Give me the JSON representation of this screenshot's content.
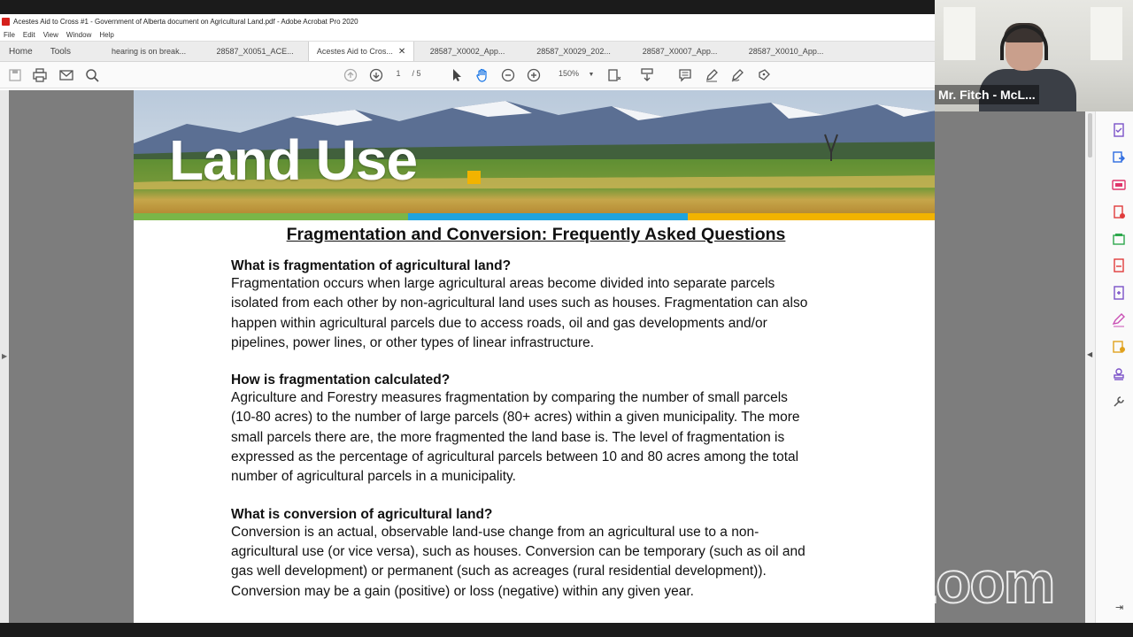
{
  "window": {
    "title": "Acestes Aid to Cross #1 - Government of Alberta document on Agricultural Land.pdf - Adobe Acrobat Pro 2020"
  },
  "menu": [
    "File",
    "Edit",
    "View",
    "Window",
    "Help"
  ],
  "nav_tabs": [
    "Home",
    "Tools"
  ],
  "doc_tabs": [
    {
      "label": "hearing is on break..."
    },
    {
      "label": "28587_X0051_ACE..."
    },
    {
      "label": "Acestes Aid to Cros...",
      "active": true
    },
    {
      "label": "28587_X0002_App..."
    },
    {
      "label": "28587_X0029_202..."
    },
    {
      "label": "28587_X0007_App..."
    },
    {
      "label": "28587_X0010_App..."
    }
  ],
  "toolbar": {
    "page_current": "1",
    "page_total": "/ 5",
    "zoom": "150%"
  },
  "document": {
    "banner_title": "Land Use",
    "banner_dot": ".",
    "stripe_colors": [
      "#7ab648",
      "#1fa3dd",
      "#f2b300"
    ],
    "heading": "Fragmentation and Conversion: Frequently Asked Questions",
    "sections": [
      {
        "question": "What is fragmentation of agricultural land?",
        "lines": [
          "Fragmentation occurs when large agricultural areas become divided into separate parcels",
          "isolated from each other by non-agricultural land uses such as houses.  Fragmentation can also",
          "happen within agricultural parcels due to access roads, oil and gas developments and/or",
          "pipelines, power lines, or other types of linear infrastructure."
        ]
      },
      {
        "question": "How is fragmentation calculated?",
        "lines": [
          "Agriculture and Forestry measures fragmentation by comparing the number of small parcels",
          "(10-80 acres) to the number of large parcels (80+ acres) within a given municipality.  The more",
          "small parcels there are, the more fragmented the land base is.  The level of fragmentation is",
          "expressed as the percentage of agricultural parcels between 10 and 80 acres among the total",
          "number of agricultural parcels in a municipality."
        ]
      },
      {
        "question": "What is conversion of agricultural land?",
        "lines": [
          "Conversion is an actual, observable land-use change from an agricultural use to a non-",
          "agricultural use (or vice versa), such as houses.  Conversion can be temporary (such as oil and",
          "gas well development) or permanent (such as acreages (rural residential development)).",
          "Conversion may be a gain (positive) or loss (negative) within any given year."
        ]
      }
    ]
  },
  "video": {
    "participant_name": "Mr. Fitch - McL..."
  },
  "watermark": "zoom",
  "colors": {
    "acrobat_red": "#d5201c",
    "doc_grey": "#7d7d7d"
  }
}
